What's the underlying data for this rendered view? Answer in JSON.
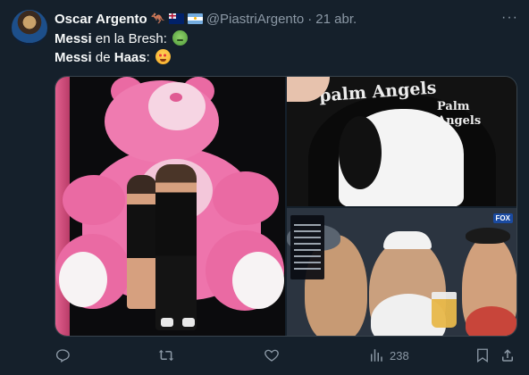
{
  "tweet": {
    "author_name": "Oscar Argento",
    "author_handle": "@PiastriArgento",
    "separator": "·",
    "date": "21 abr.",
    "line1": {
      "bold": "Messi",
      "text": " en la Bresh:"
    },
    "line2": {
      "bold_a": "Messi",
      "text_mid": " de ",
      "bold_b": "Haas",
      "text_end": ":"
    },
    "emojis": [
      "nauseated-face-icon",
      "star-struck-face-icon"
    ],
    "media": {
      "images": [
        {
          "description_icon": "pink-bear-photo"
        },
        {
          "description_icon": "palm-angels-hoodie-photo",
          "text_top": "palm Angels",
          "text_side": "Palm\nAngels"
        },
        {
          "description_icon": "f1-fans-photo",
          "badge": "FOX"
        }
      ]
    },
    "actions": {
      "views": "238"
    }
  },
  "colors": {
    "background": "#15202b",
    "text": "#f7f9f9",
    "secondary": "#8b98a5"
  }
}
